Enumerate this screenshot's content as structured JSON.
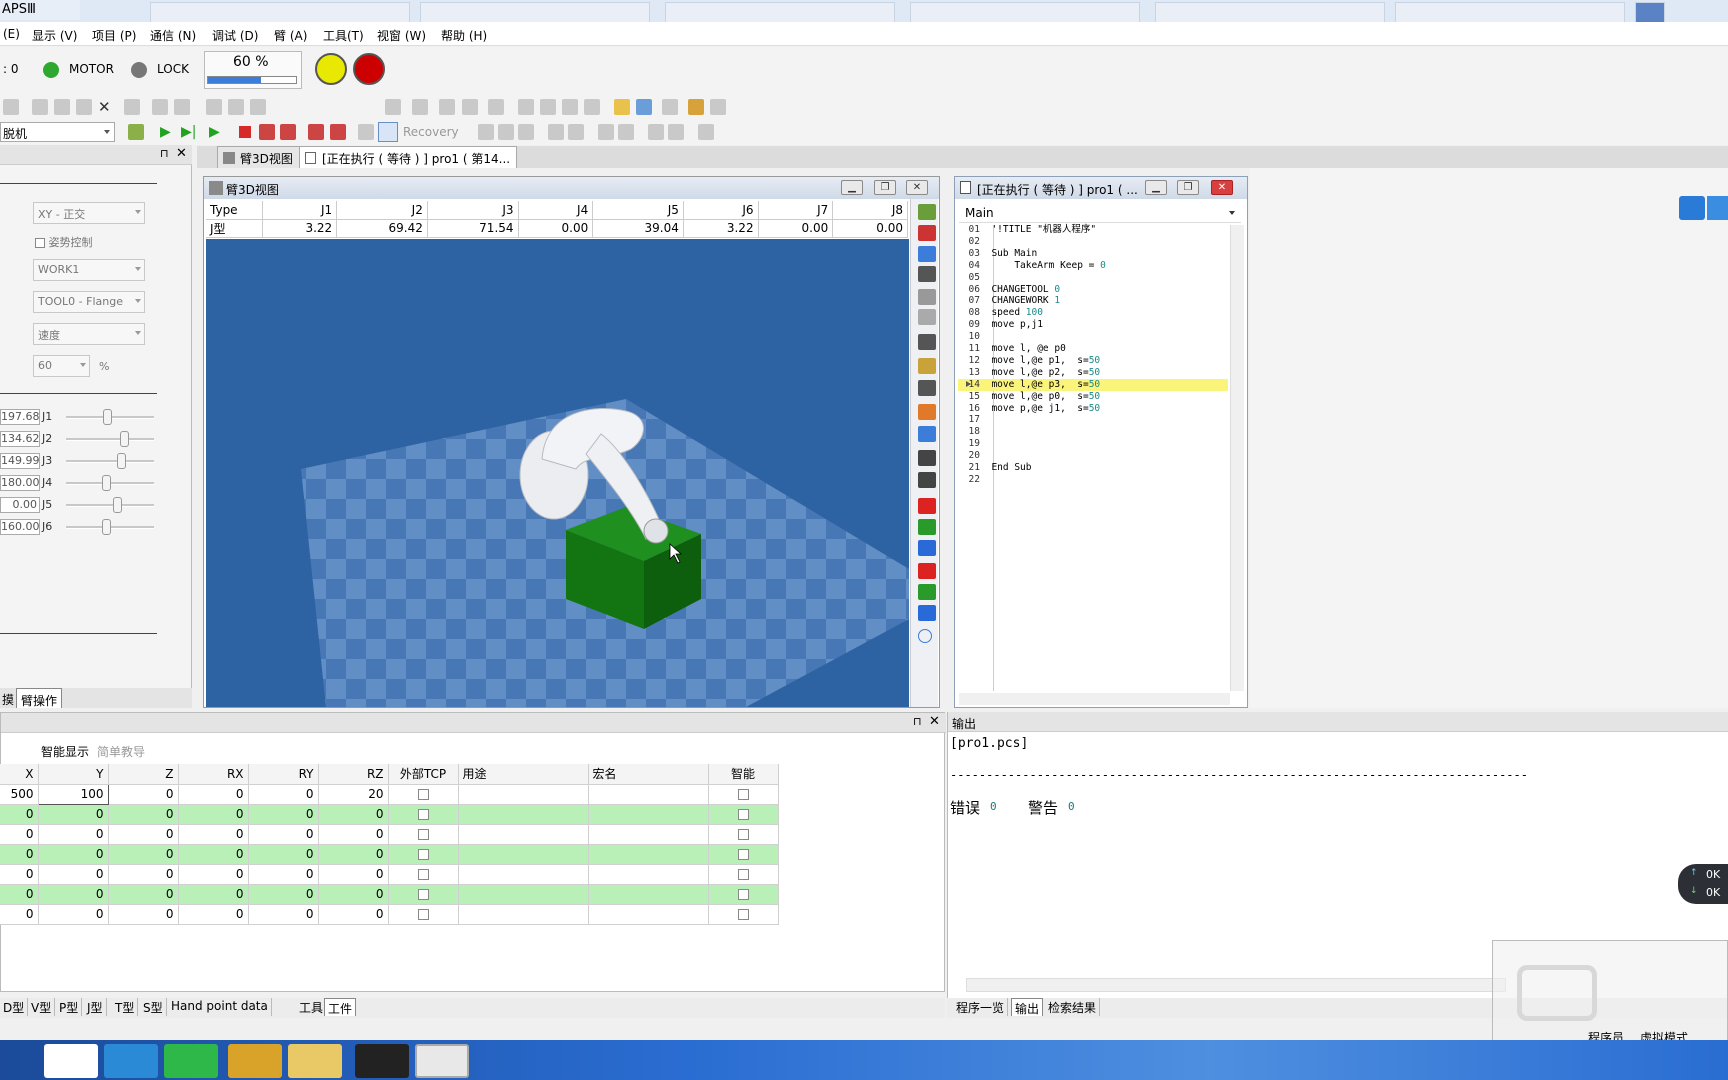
{
  "app": {
    "title": "APSⅢ"
  },
  "menu": [
    "(E)",
    "显示 (V)",
    "项目 (P)",
    "通信 (N)",
    "调试 (D)",
    "臂 (A)",
    "工具(T)",
    "视窗 (W)",
    "帮助 (H)"
  ],
  "status": {
    "prefix": ": 0",
    "motor_label": "MOTOR",
    "lock_label": "LOCK",
    "speed_percent": "60 %",
    "speed_fraction": 0.6,
    "colors": {
      "motor": "#2ea82e",
      "lock": "#777777",
      "yellow": "#e8e800",
      "red": "#cc0000"
    }
  },
  "toolbar2": {
    "mode_select": "脱机",
    "recovery_label": "Recovery"
  },
  "tabs": {
    "arm3d": "臂3D视图",
    "program": "[正在执行 ( 等待 ) ] pro1 ( 第14..."
  },
  "left_panel": {
    "coord_select": "XY - 正交",
    "posture_label": "姿势控制",
    "work_select": "WORK1",
    "tool_select": "TOOL0 - Flange",
    "speed_select": "速度",
    "speed_value": "60",
    "percent": "%",
    "joints": [
      {
        "label": "J1",
        "value": "197.68",
        "pos": 0.47
      },
      {
        "label": "J2",
        "value": "134.62",
        "pos": 0.66
      },
      {
        "label": "J3",
        "value": "149.99",
        "pos": 0.62
      },
      {
        "label": "J4",
        "value": "180.00",
        "pos": 0.46
      },
      {
        "label": "J5",
        "value": "0.00",
        "pos": 0.58
      },
      {
        "label": "J6",
        "value": "160.00",
        "pos": 0.46
      }
    ],
    "tab_left": "摸",
    "tab_active": "臂操作"
  },
  "arm3d_window": {
    "title": "臂3D视图",
    "headers": [
      "Type",
      "J1",
      "J2",
      "J3",
      "J4",
      "J5",
      "J6",
      "J7",
      "J8"
    ],
    "row": [
      "J型",
      "3.22",
      "69.42",
      "71.54",
      "0.00",
      "39.04",
      "3.22",
      "0.00",
      "0.00"
    ]
  },
  "program_window": {
    "title": "[正在执行 ( 等待 ) ] pro1 ( ...",
    "routine": "Main",
    "current_line": "14",
    "lines": [
      {
        "no": "01",
        "text": "'!TITLE \"机器人程序\""
      },
      {
        "no": "02",
        "text": ""
      },
      {
        "no": "03",
        "text": "Sub Main"
      },
      {
        "no": "04",
        "text": "    TakeArm Keep = 0"
      },
      {
        "no": "05",
        "text": ""
      },
      {
        "no": "06",
        "text": "CHANGETOOL 0"
      },
      {
        "no": "07",
        "text": "CHANGEWORK 1"
      },
      {
        "no": "08",
        "text": "speed 100"
      },
      {
        "no": "09",
        "text": "move p,j1"
      },
      {
        "no": "10",
        "text": ""
      },
      {
        "no": "11",
        "text": "move l, @e p0"
      },
      {
        "no": "12",
        "text": "move l,@e p1,  s=50"
      },
      {
        "no": "13",
        "text": "move l,@e p2,  s=50"
      },
      {
        "no": "14",
        "text": "move l,@e p3,  s=50"
      },
      {
        "no": "15",
        "text": "move l,@e p0,  s=50"
      },
      {
        "no": "16",
        "text": "move p,@e j1,  s=50"
      },
      {
        "no": "17",
        "text": ""
      },
      {
        "no": "18",
        "text": ""
      },
      {
        "no": "19",
        "text": ""
      },
      {
        "no": "20",
        "text": ""
      },
      {
        "no": "21",
        "text": "End Sub"
      },
      {
        "no": "22",
        "text": ""
      }
    ]
  },
  "var_panel": {
    "mode_smart": "智能显示",
    "mode_simple": "简单教导",
    "headers": [
      "X",
      "Y",
      "Z",
      "RX",
      "RY",
      "RZ",
      "外部TCP",
      "用途",
      "宏名",
      "智能"
    ],
    "rows": [
      [
        "500",
        "100",
        "0",
        "0",
        "0",
        "20"
      ],
      [
        "0",
        "0",
        "0",
        "0",
        "0",
        "0"
      ],
      [
        "0",
        "0",
        "0",
        "0",
        "0",
        "0"
      ],
      [
        "0",
        "0",
        "0",
        "0",
        "0",
        "0"
      ],
      [
        "0",
        "0",
        "0",
        "0",
        "0",
        "0"
      ],
      [
        "0",
        "0",
        "0",
        "0",
        "0",
        "0"
      ],
      [
        "0",
        "0",
        "0",
        "0",
        "0",
        "0"
      ]
    ],
    "tabs": [
      "D型",
      "V型",
      "P型",
      "J型",
      "T型",
      "S型",
      "Hand point data",
      "工具",
      "工件"
    ],
    "active_tab": "工件"
  },
  "output_panel": {
    "title": "输出",
    "file": "[pro1.pcs]",
    "divider": "--------------------------------------------------------------------------------",
    "error_label": "错误",
    "error_count": "0",
    "warn_label": "警告",
    "warn_count": "0",
    "tabs": [
      "程序一览",
      "输出",
      "检索结果"
    ],
    "active_tab": "输出"
  },
  "overlay": {
    "role": "程序员",
    "mode": "虚拟模式",
    "net_up": "0K",
    "net_down": "0K"
  }
}
